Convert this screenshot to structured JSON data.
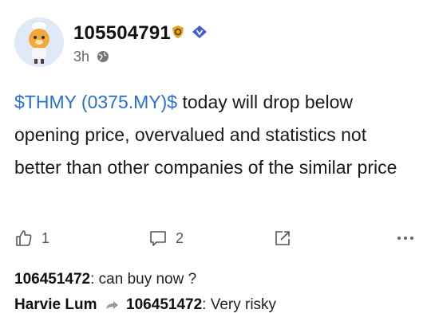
{
  "post": {
    "username": "105504791",
    "time": "3h",
    "ticker": "$THMY (0375.MY)$",
    "body": " today will drop below opening price, overvalued and statistics not better than other companies of the similar price",
    "likes": "1",
    "comments": "2"
  },
  "replies": [
    {
      "author": "106451472",
      "text": ": can buy now ?"
    },
    {
      "author": "Harvie Lum",
      "reply_to": "106451472",
      "text": ": Very risky"
    }
  ],
  "colors": {
    "ticker": "#2a6fd6",
    "badge_gold": "#e2a51b",
    "badge_blue": "#3a5fd9"
  },
  "icons": [
    "globe-icon",
    "like-icon",
    "comment-icon",
    "share-icon",
    "more-icon",
    "reply-arrow-icon"
  ]
}
